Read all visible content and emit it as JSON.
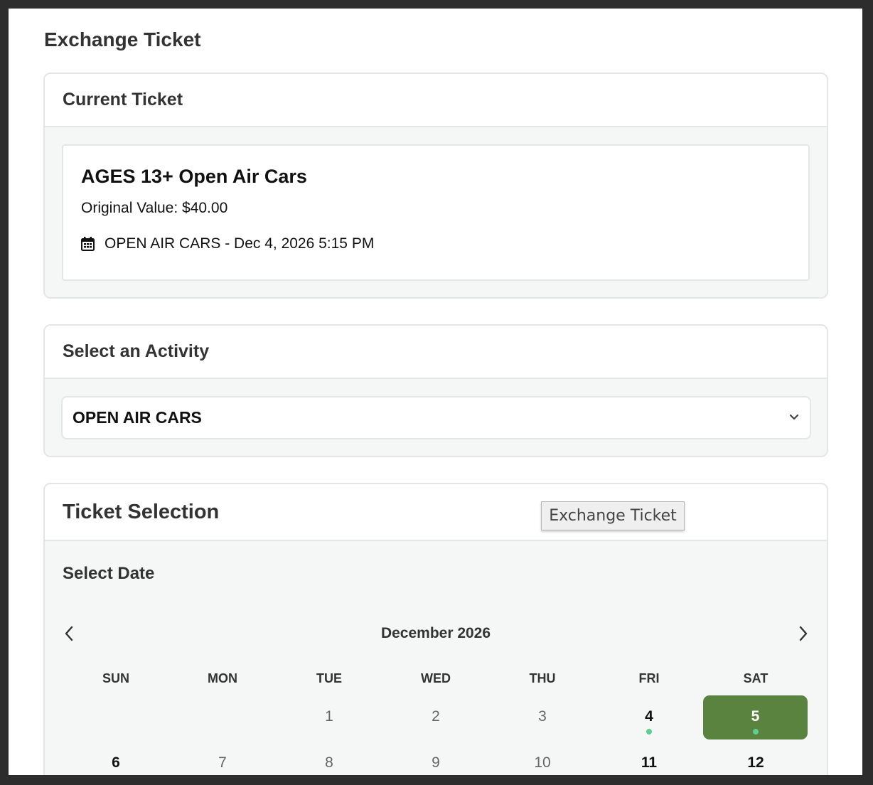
{
  "modal": {
    "title": "Exchange Ticket"
  },
  "current_ticket": {
    "header": "Current Ticket",
    "name": "AGES 13+ Open Air Cars",
    "original_value": "Original Value: $40.00",
    "event": "OPEN AIR CARS - Dec 4, 2026 5:15 PM",
    "event_icon": "calendar-icon"
  },
  "activity": {
    "header": "Select an Activity",
    "selected": "OPEN AIR CARS",
    "chevron_icon": "chevron-down-icon"
  },
  "ticket_selection": {
    "header": "Ticket Selection",
    "tooltip": "Exchange Ticket",
    "select_date_label": "Select Date"
  },
  "calendar": {
    "month": "December 2026",
    "prev_icon": "chevron-left-icon",
    "next_icon": "chevron-right-icon",
    "weekdays": [
      "SUN",
      "MON",
      "TUE",
      "WED",
      "THU",
      "FRI",
      "SAT"
    ],
    "weeks": [
      [
        {
          "day": "",
          "available": false,
          "selected": false
        },
        {
          "day": "",
          "available": false,
          "selected": false
        },
        {
          "day": "1",
          "available": false,
          "selected": false
        },
        {
          "day": "2",
          "available": false,
          "selected": false
        },
        {
          "day": "3",
          "available": false,
          "selected": false
        },
        {
          "day": "4",
          "available": true,
          "selected": false
        },
        {
          "day": "5",
          "available": true,
          "selected": true
        }
      ],
      [
        {
          "day": "6",
          "available": true,
          "selected": false
        },
        {
          "day": "7",
          "available": false,
          "selected": false
        },
        {
          "day": "8",
          "available": false,
          "selected": false
        },
        {
          "day": "9",
          "available": false,
          "selected": false
        },
        {
          "day": "10",
          "available": false,
          "selected": false
        },
        {
          "day": "11",
          "available": true,
          "selected": false
        },
        {
          "day": "12",
          "available": true,
          "selected": false
        }
      ]
    ],
    "colors": {
      "selected_bg": "#5b8340",
      "available_dot": "#5fce8f"
    }
  }
}
